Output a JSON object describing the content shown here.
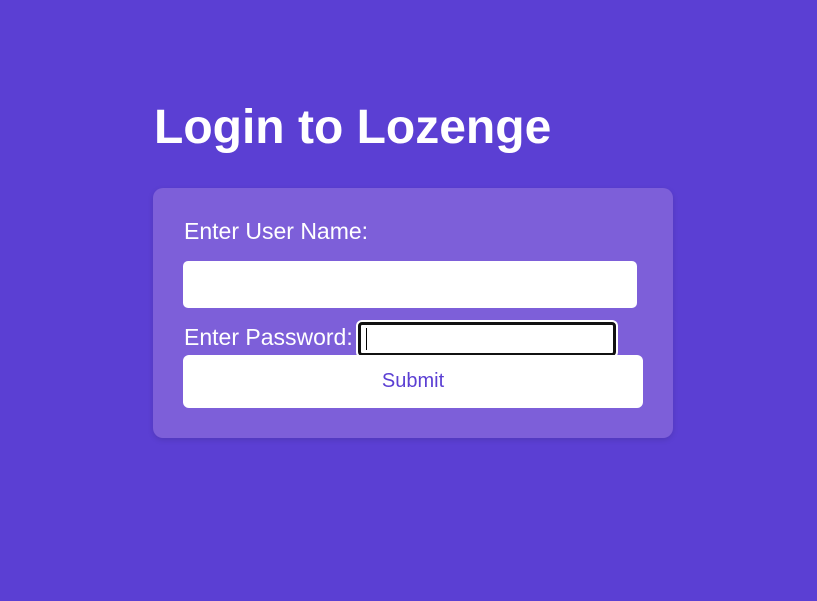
{
  "page": {
    "title": "Login to Lozenge"
  },
  "form": {
    "username_label": "Enter User Name:",
    "username_value": "",
    "password_label": "Enter Password:",
    "password_value": "",
    "submit_label": "Submit"
  },
  "colors": {
    "background": "#5b3fd3",
    "card": "#7d5fd9",
    "accent_text": "#5b3fd3",
    "text": "#ffffff"
  }
}
